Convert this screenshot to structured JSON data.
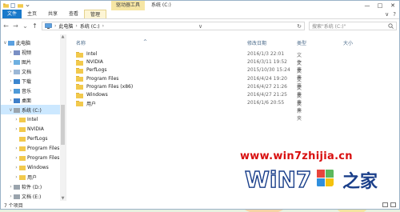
{
  "titlebar": {
    "context_tab": "驱动器工具",
    "window_title": "系统 (C:)",
    "minimize": "—",
    "maximize": "□",
    "close": "✕"
  },
  "ribbon": {
    "tabs": [
      "文件",
      "主页",
      "共享",
      "查看",
      "管理"
    ],
    "expand": "∨",
    "help": "?"
  },
  "address": {
    "crumbs": [
      "此电脑",
      "系统 (C:)"
    ],
    "dropdown": "∨",
    "refresh": "↻",
    "search_placeholder": "搜索\"系统 (C:)\""
  },
  "sidebar": {
    "items": [
      {
        "label": "此电脑",
        "icon": "computer-icon",
        "chevron": "∨",
        "indent": 0
      },
      {
        "label": "视频",
        "icon": "video-folder-icon",
        "chevron": "›",
        "indent": 1
      },
      {
        "label": "图片",
        "icon": "pictures-folder-icon",
        "chevron": "›",
        "indent": 1
      },
      {
        "label": "文档",
        "icon": "documents-folder-icon",
        "chevron": "›",
        "indent": 1
      },
      {
        "label": "下载",
        "icon": "downloads-folder-icon",
        "chevron": "›",
        "indent": 1
      },
      {
        "label": "音乐",
        "icon": "music-folder-icon",
        "chevron": "›",
        "indent": 1
      },
      {
        "label": "桌面",
        "icon": "desktop-folder-icon",
        "chevron": "›",
        "indent": 1
      },
      {
        "label": "系统 (C:)",
        "icon": "drive-icon",
        "chevron": "∨",
        "indent": 1,
        "selected": true
      },
      {
        "label": "Intel",
        "icon": "folder-icon",
        "chevron": "›",
        "indent": 2
      },
      {
        "label": "NVIDIA",
        "icon": "folder-icon",
        "chevron": "›",
        "indent": 2
      },
      {
        "label": "PerfLogs",
        "icon": "folder-icon",
        "chevron": "",
        "indent": 2
      },
      {
        "label": "Program Files",
        "icon": "folder-icon",
        "chevron": "›",
        "indent": 2
      },
      {
        "label": "Program Files",
        "icon": "folder-icon",
        "chevron": "›",
        "indent": 2
      },
      {
        "label": "Windows",
        "icon": "folder-icon",
        "chevron": "›",
        "indent": 2
      },
      {
        "label": "用户",
        "icon": "folder-icon",
        "chevron": "›",
        "indent": 2
      },
      {
        "label": "软件 (D:)",
        "icon": "drive-icon",
        "chevron": "›",
        "indent": 1
      },
      {
        "label": "文档 (E:)",
        "icon": "drive-icon",
        "chevron": "›",
        "indent": 1
      }
    ]
  },
  "content": {
    "columns": {
      "name": "名称",
      "date": "修改日期",
      "type": "类型",
      "size": "大小"
    },
    "sort_indicator": "^",
    "files": [
      {
        "name": "Intel",
        "date": "2016/1/3 22:01",
        "type": "文件夹"
      },
      {
        "name": "NVIDIA",
        "date": "2016/3/11 19:52",
        "type": "文件夹"
      },
      {
        "name": "PerfLogs",
        "date": "2015/10/30 15:24",
        "type": "文件夹"
      },
      {
        "name": "Program Files",
        "date": "2016/4/24 19:20",
        "type": "文件夹"
      },
      {
        "name": "Program Files (x86)",
        "date": "2016/4/27 21:26",
        "type": "文件夹"
      },
      {
        "name": "Windows",
        "date": "2016/4/27 21:25",
        "type": "文件夹"
      },
      {
        "name": "用户",
        "date": "2016/1/6 20:55",
        "type": "文件夹"
      }
    ]
  },
  "status": {
    "text": "7 个项目"
  },
  "watermark": {
    "url": "www.win7zhijia.cn",
    "logo_text": "Win7之家"
  },
  "colors": {
    "accent": "#1979ca",
    "folder": "#f2c94c",
    "selection": "#cce8ff",
    "watermark": "#d80f0f"
  }
}
